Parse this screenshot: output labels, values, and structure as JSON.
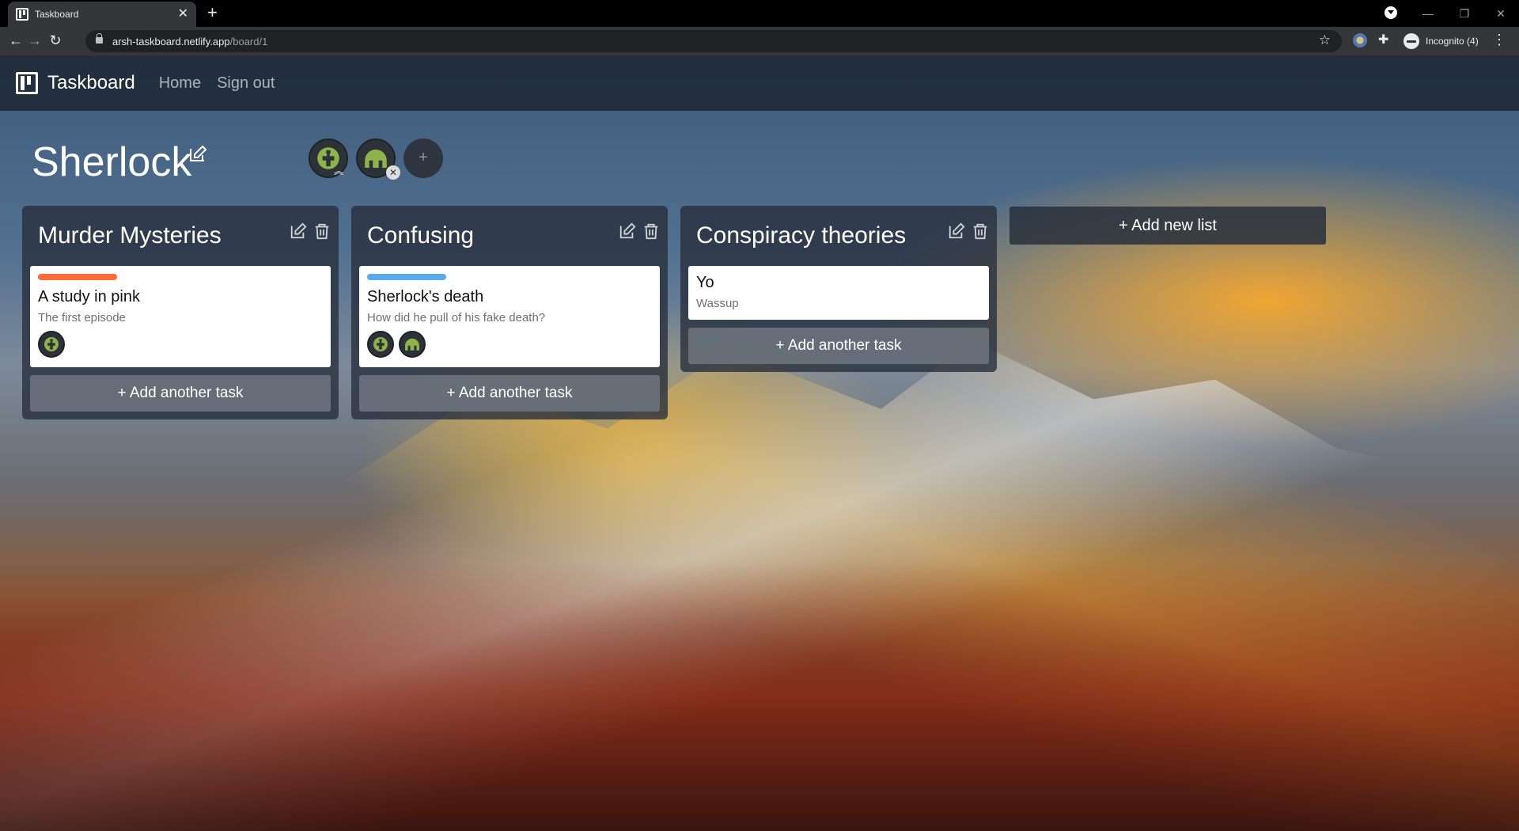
{
  "browser": {
    "tab_title": "Taskboard",
    "new_tab": "+",
    "close_tab": "✕",
    "url_host": "arsh-taskboard.netlify.app",
    "url_path": "/board/1",
    "profile_label": "Incognito (4)",
    "window_minimize": "—",
    "window_restore": "❐",
    "window_close": "✕"
  },
  "nav": {
    "brand": "Taskboard",
    "links": [
      "Home",
      "Sign out"
    ]
  },
  "board": {
    "title": "Sherlock",
    "add_member": "+",
    "add_list": "+ Add new list",
    "lists": [
      {
        "title": "Murder Mysteries",
        "add_task": "+ Add another task",
        "cards": [
          {
            "title": "A study in pink",
            "description": "The first episode",
            "label_color": "#ff6b35",
            "members": [
              "avatar-1"
            ]
          }
        ]
      },
      {
        "title": "Confusing",
        "add_task": "+ Add another task",
        "cards": [
          {
            "title": "Sherlock's death",
            "description": "How did he pull of his fake death?",
            "label_color": "#5aa9f0",
            "members": [
              "avatar-1",
              "avatar-2"
            ]
          }
        ]
      },
      {
        "title": "Conspiracy theories",
        "add_task": "+ Add another task",
        "cards": [
          {
            "title": "Yo",
            "description": "Wassup",
            "label_color": "",
            "members": []
          }
        ]
      }
    ]
  },
  "colors": {
    "nav_bg": "#1c2430",
    "avatar_green": "#8db34a",
    "label_orange": "#ff6b35",
    "label_blue": "#5aa9f0"
  }
}
